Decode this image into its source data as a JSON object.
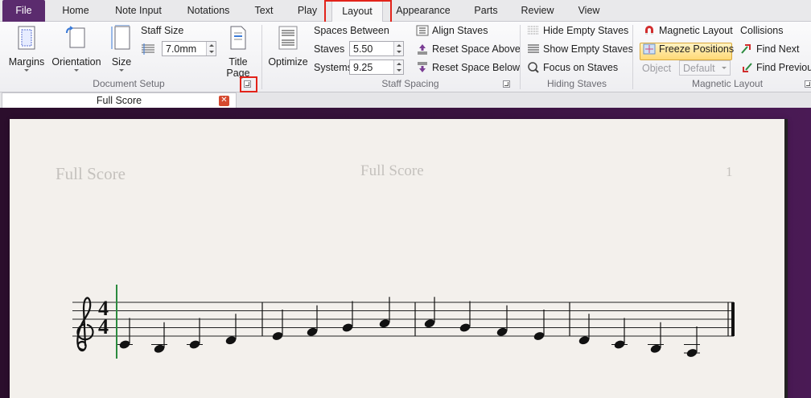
{
  "tabs": [
    "File",
    "Home",
    "Note Input",
    "Notations",
    "Text",
    "Play",
    "Layout",
    "Appearance",
    "Parts",
    "Review",
    "View"
  ],
  "active_tab": "Layout",
  "ribbon": {
    "document_setup": {
      "label": "Document Setup",
      "margins": "Margins",
      "orientation": "Orientation",
      "size": "Size",
      "staff_size_label": "Staff Size",
      "staff_size_value": "7.0mm",
      "title_page_line1": "Title",
      "title_page_line2": "Page"
    },
    "staff_spacing": {
      "label": "Staff Spacing",
      "optimize": "Optimize",
      "spaces_between": "Spaces Between",
      "staves_label": "Staves",
      "staves_value": "5.50",
      "systems_label": "Systems",
      "systems_value": "9.25",
      "align_staves": "Align Staves",
      "reset_space_above": "Reset Space Above",
      "reset_space_below": "Reset Space Below"
    },
    "hiding_staves": {
      "label": "Hiding Staves",
      "hide_empty": "Hide Empty Staves",
      "show_empty": "Show Empty Staves",
      "focus": "Focus on Staves"
    },
    "magnetic_layout": {
      "label": "Magnetic Layout",
      "magnetic_layout": "Magnetic Layout",
      "freeze_positions": "Freeze Positions",
      "object_label": "Object",
      "object_value": "Default",
      "collisions": "Collisions",
      "find_next": "Find Next",
      "find_previous": "Find Previous"
    }
  },
  "document_tab": {
    "title": "Full Score",
    "close": "✕"
  },
  "score": {
    "header_left": "Full Score",
    "header_center": "Full Score",
    "page_number": "1",
    "time_signature_top": "4",
    "time_signature_bottom": "4",
    "notes": [
      "C4",
      "B3",
      "C4",
      "D4",
      "E4",
      "F4",
      "G4",
      "A4",
      "A4",
      "G4",
      "F4",
      "E4",
      "D4",
      "C4",
      "B3",
      "A3"
    ]
  },
  "colors": {
    "file_tab": "#5b2b6e",
    "highlight": "#e2231a",
    "page": "#f3f0ec",
    "cursor": "#2b8a3e"
  }
}
